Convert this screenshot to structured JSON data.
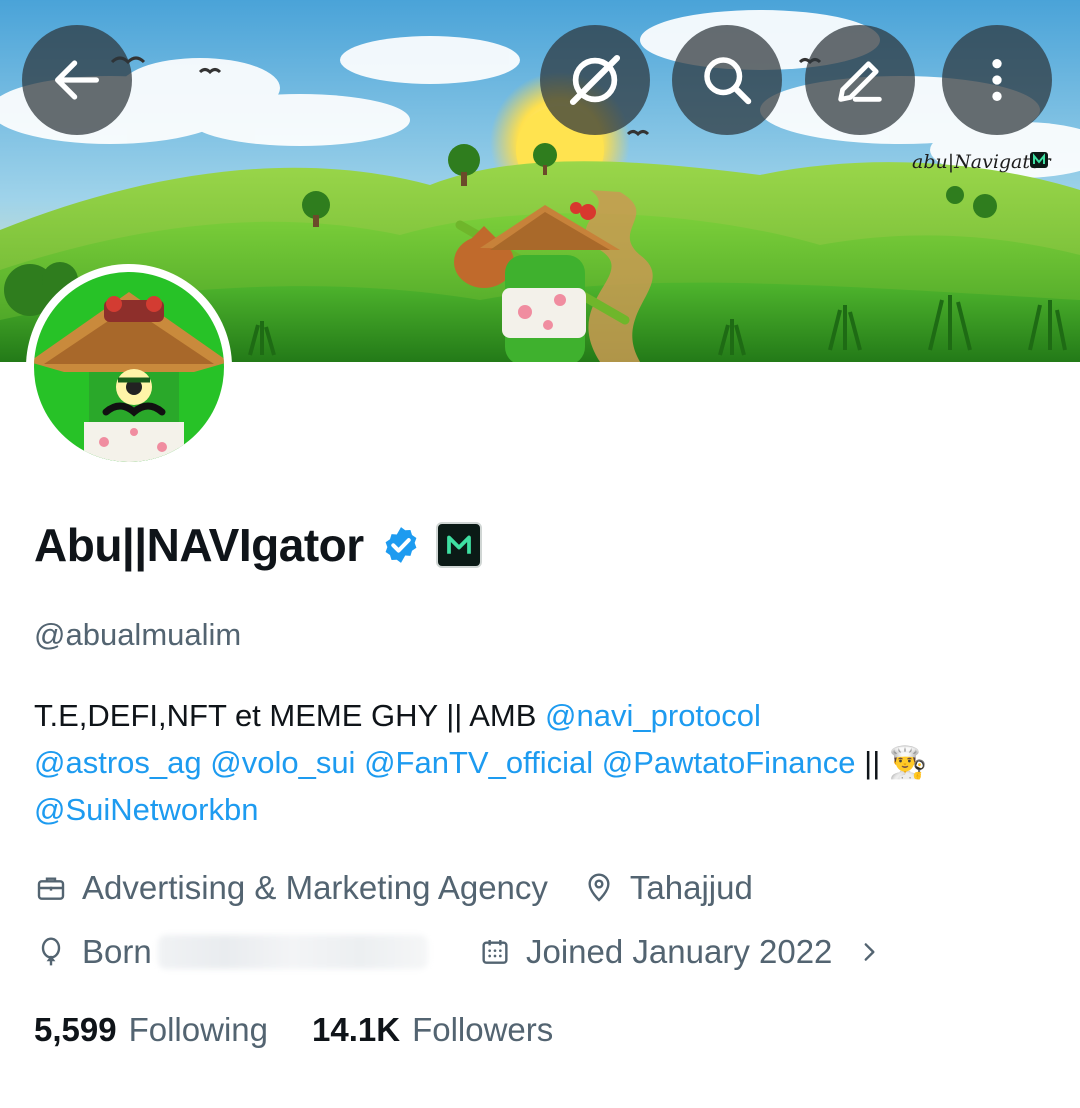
{
  "header": {
    "back_icon": "arrow-left-icon",
    "grok_icon": "grok-slash-icon",
    "search_icon": "search-icon",
    "edit_icon": "pencil-icon",
    "more_icon": "more-vertical-icon",
    "banner_signature": "abu|Navigator"
  },
  "profile": {
    "display_name": "Abu||NAVIgator",
    "handle": "@abualmualim",
    "verified": true,
    "bio": {
      "text_start": "T.E,DEFI,NFT et MEME GHY || AMB ",
      "mention_1": "@navi_protocol",
      "mention_2": "@astros_ag",
      "mention_3": "@volo_sui",
      "mention_4": "@FanTV_official",
      "mention_5": "@PawtatoFinance",
      "separator": " || ",
      "emoji": "👨‍🍳",
      "mention_6": "@SuiNetworkbn"
    },
    "category": "Advertising & Marketing Agency",
    "location": "Tahajjud",
    "born_label": "Born",
    "joined": "Joined January 2022"
  },
  "stats": {
    "following_count": "5,599",
    "following_label": "Following",
    "followers_count": "14.1K",
    "followers_label": "Followers"
  },
  "colors": {
    "accent": "#1d9bf0",
    "secondary_text": "#536471",
    "primary_text": "#0f1419"
  }
}
